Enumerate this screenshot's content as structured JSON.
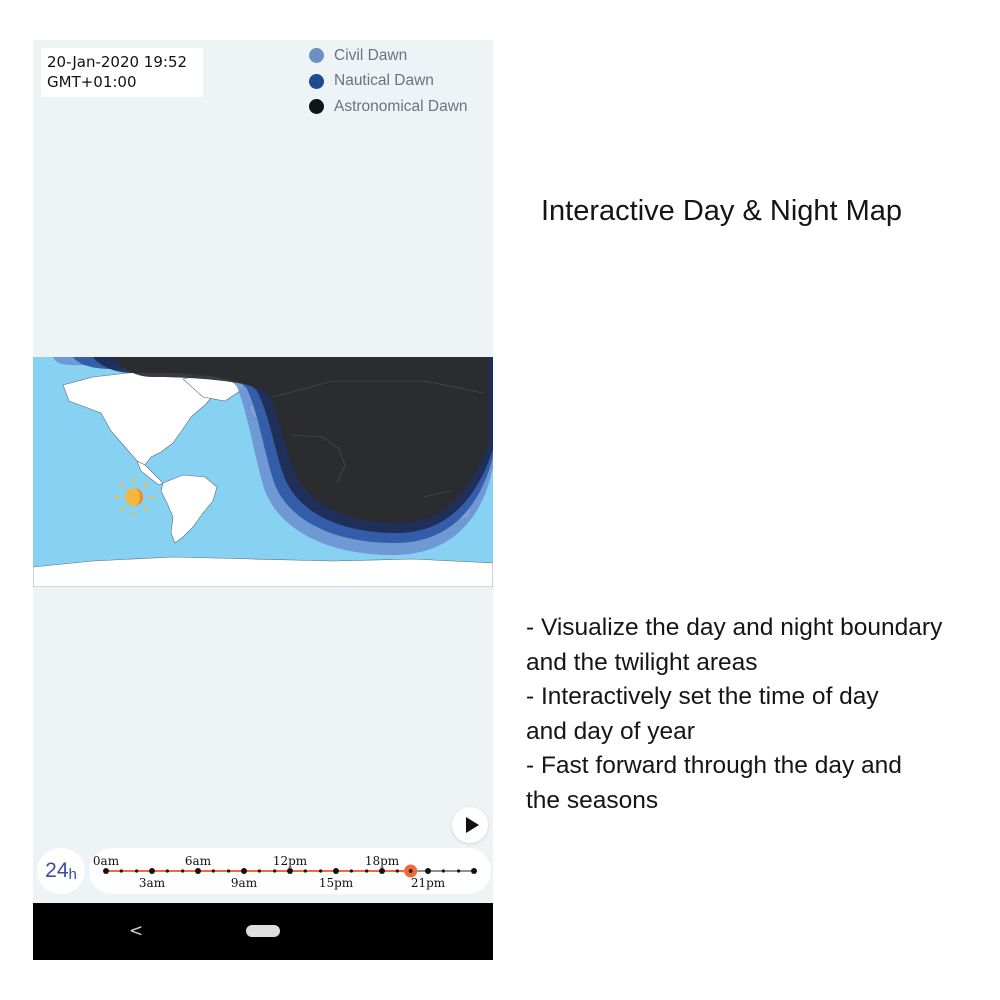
{
  "status": {
    "datetime": "20-Jan-2020 19:52",
    "timezone": "GMT+01:00"
  },
  "legend": [
    {
      "label": "Civil Dawn",
      "color": "#6d91c3"
    },
    {
      "label": "Nautical Dawn",
      "color": "#1f4b8e"
    },
    {
      "label": "Astronomical Dawn",
      "color": "#12141c"
    }
  ],
  "map": {
    "colors": {
      "ocean": "#87d2f2",
      "land": "#ffffff",
      "civil": "#6b8fd0",
      "nautical": "#2c56a3",
      "astronomical": "#1d2b52",
      "night": "#2c2c2c",
      "sun": "#f08a1c"
    },
    "sun_icon": "sun-icon"
  },
  "controls": {
    "play_icon": "play-icon",
    "mode_number": "24",
    "mode_unit": "h"
  },
  "timeline": {
    "labels_top": [
      "0am",
      "6am",
      "12pm",
      "18pm"
    ],
    "labels_bottom": [
      "3am",
      "9am",
      "15pm",
      "21pm"
    ],
    "hours_total": 24,
    "current_hour": 19.87,
    "progress_color": "#f26a3a"
  },
  "navbar": {
    "back_glyph": "<",
    "back_icon": "back-icon",
    "home_icon": "home-pill-icon"
  },
  "description": {
    "title": "Interactive Day & Night Map",
    "features": [
      "- Visualize the day and night boundary",
      "and the twilight areas",
      "- Interactively set the time of day",
      "and day of year",
      "- Fast forward through the day and",
      "the seasons"
    ]
  }
}
